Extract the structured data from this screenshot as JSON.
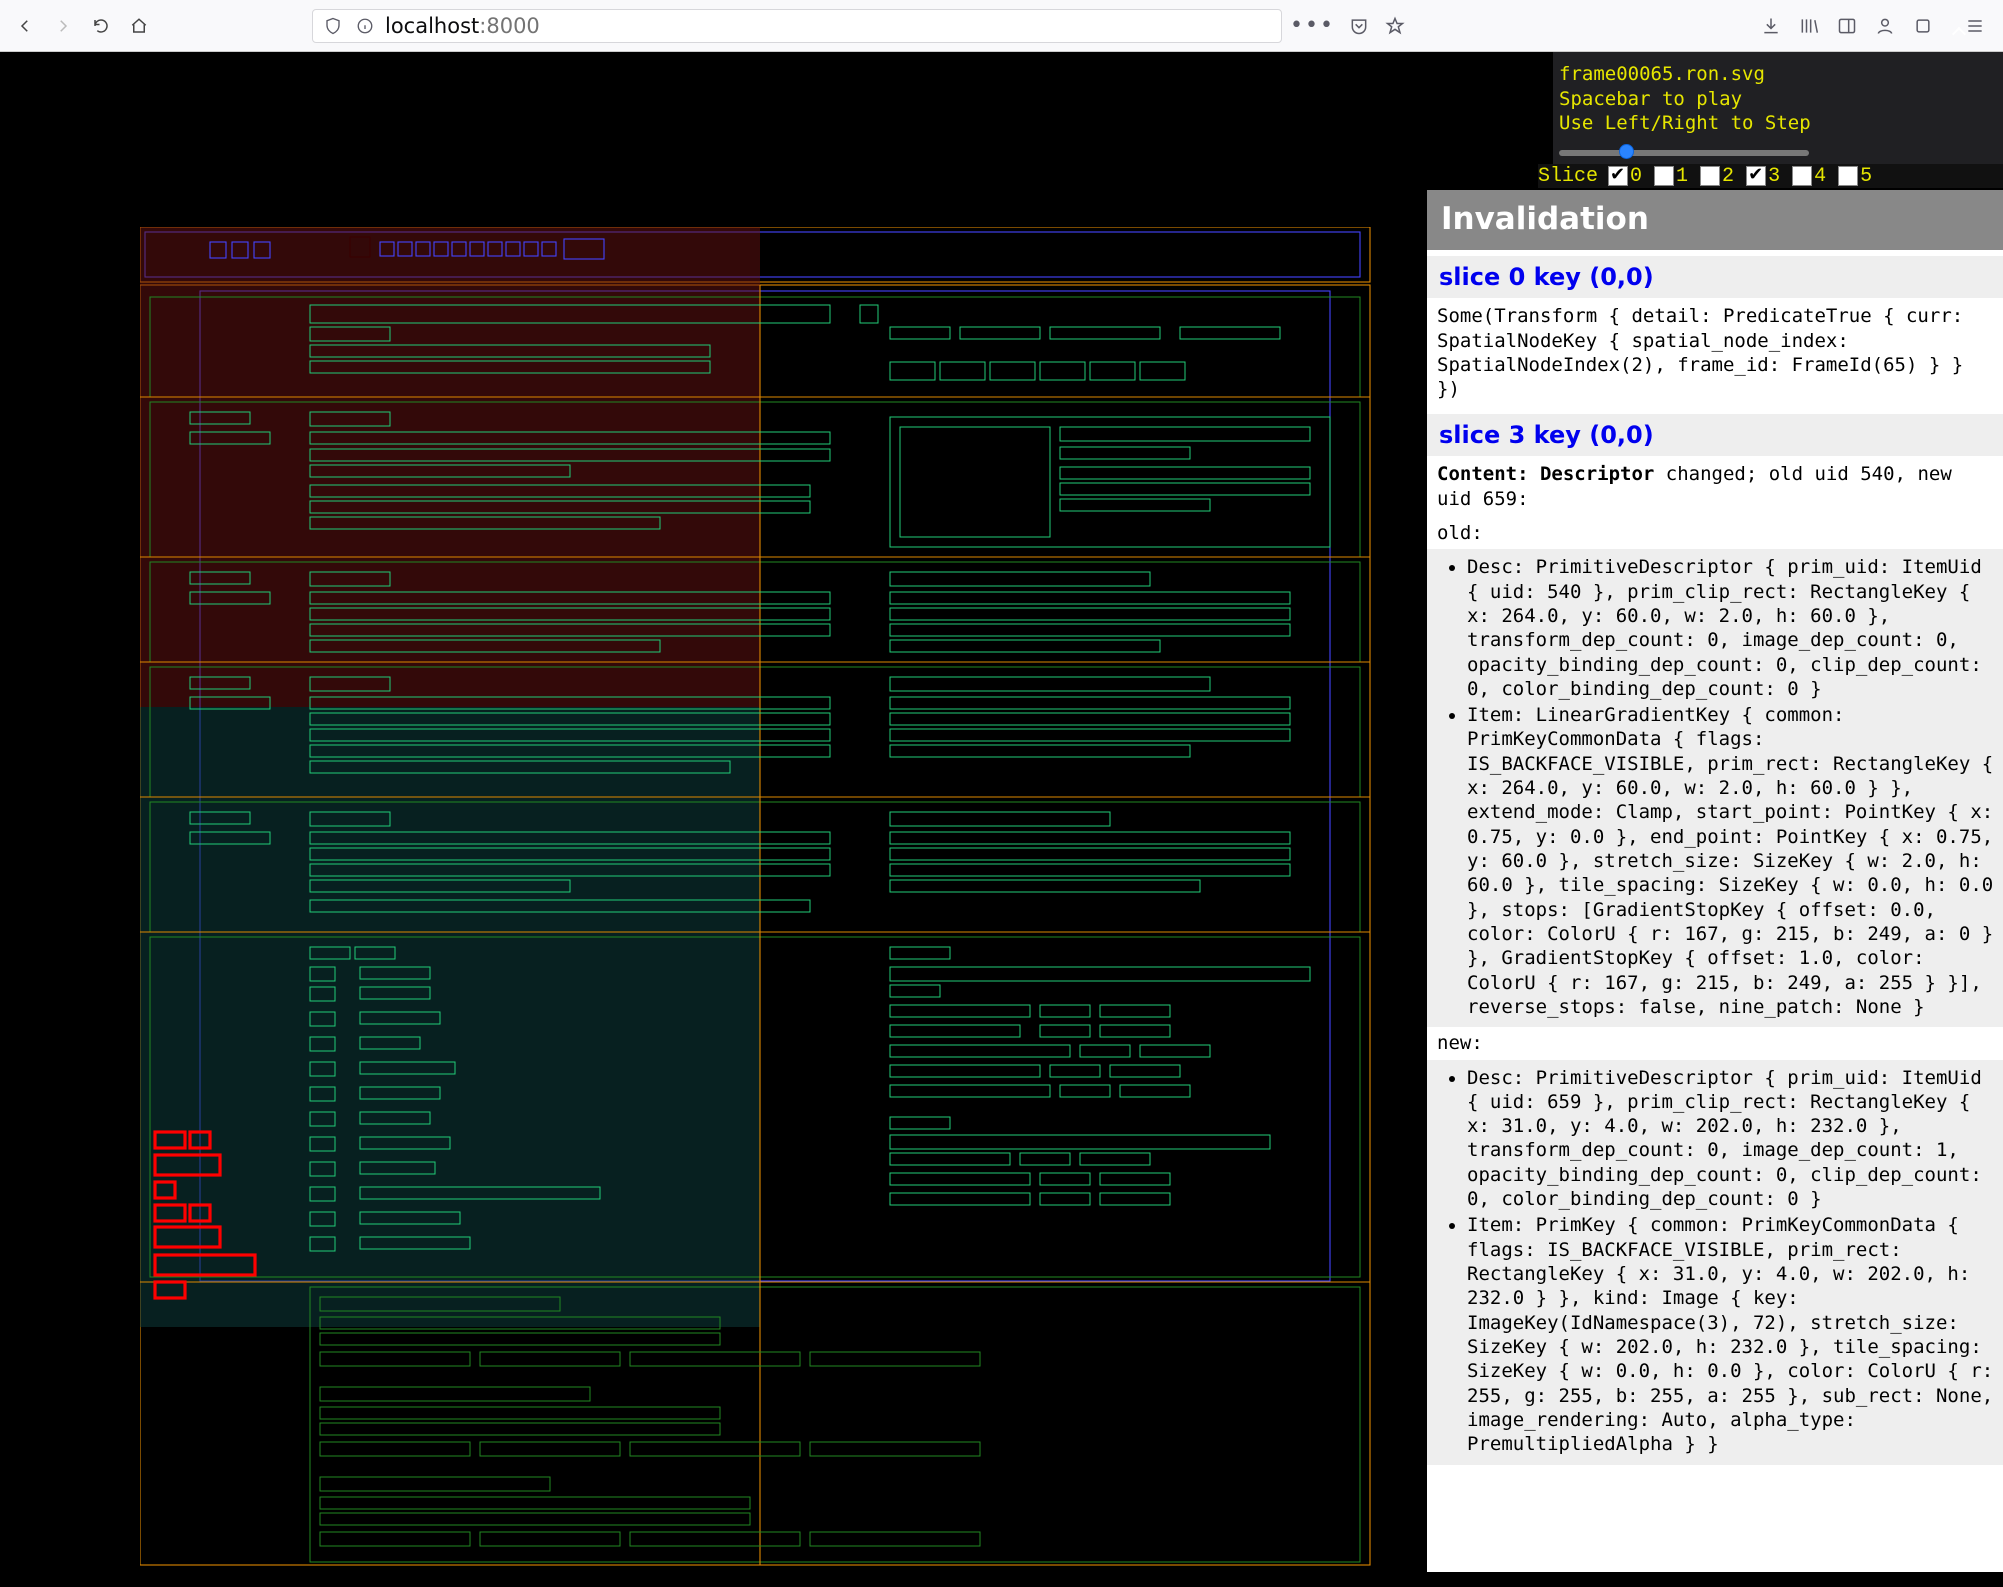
{
  "browser": {
    "hostname": "localhost",
    "port": ":8000"
  },
  "header": {
    "filename": "frame00065.ron.svg",
    "hint_play": "Spacebar to play",
    "hint_step": "Use Left/Right to Step"
  },
  "slicebar": {
    "label": "Slice",
    "options": [
      {
        "n": "0",
        "checked": true
      },
      {
        "n": "1",
        "checked": false
      },
      {
        "n": "2",
        "checked": false
      },
      {
        "n": "3",
        "checked": true
      },
      {
        "n": "4",
        "checked": false
      },
      {
        "n": "5",
        "checked": false
      }
    ]
  },
  "panel": {
    "title": "Invalidation",
    "slice0": {
      "heading": "slice 0 key (0,0)",
      "body": "Some(Transform { detail: PredicateTrue { curr: SpatialNodeKey { spatial_node_index: SpatialNodeIndex(2), frame_id: FrameId(65) } } })"
    },
    "slice3": {
      "heading": "slice 3 key (0,0)",
      "content_line_b": "Content: Descriptor",
      "content_line_rest": " changed; old uid 540, new uid 659:",
      "old_label": "old:",
      "old_items": [
        "Desc: PrimitiveDescriptor { prim_uid: ItemUid { uid: 540 }, prim_clip_rect: RectangleKey { x: 264.0, y: 60.0, w: 2.0, h: 60.0 }, transform_dep_count: 0, image_dep_count: 0, opacity_binding_dep_count: 0, clip_dep_count: 0, color_binding_dep_count: 0 }",
        "Item: LinearGradientKey { common: PrimKeyCommonData { flags: IS_BACKFACE_VISIBLE, prim_rect: RectangleKey { x: 264.0, y: 60.0, w: 2.0, h: 60.0 } }, extend_mode: Clamp, start_point: PointKey { x: 0.75, y: 0.0 }, end_point: PointKey { x: 0.75, y: 60.0 }, stretch_size: SizeKey { w: 2.0, h: 60.0 }, tile_spacing: SizeKey { w: 0.0, h: 0.0 }, stops: [GradientStopKey { offset: 0.0, color: ColorU { r: 167, g: 215, b: 249, a: 0 } }, GradientStopKey { offset: 1.0, color: ColorU { r: 167, g: 215, b: 249, a: 255 } }], reverse_stops: false, nine_patch: None }"
      ],
      "new_label": "new:",
      "new_items": [
        "Desc: PrimitiveDescriptor { prim_uid: ItemUid { uid: 659 }, prim_clip_rect: RectangleKey { x: 31.0, y: 4.0, w: 202.0, h: 232.0 }, transform_dep_count: 0, image_dep_count: 1, opacity_binding_dep_count: 0, clip_dep_count: 0, color_binding_dep_count: 0 }",
        "Item: PrimKey { common: PrimKeyCommonData { flags: IS_BACKFACE_VISIBLE, prim_rect: RectangleKey { x: 31.0, y: 4.0, w: 202.0, h: 232.0 } }, kind: Image { key: ImageKey(IdNamespace(3), 72), stretch_size: SizeKey { w: 202.0, h: 232.0 }, tile_spacing: SizeKey { w: 0.0, h: 0.0 }, color: ColorU { r: 255, g: 255, b: 255, a: 255 }, sub_rect: None, image_rendering: Auto, alpha_type: PremultipliedAlpha } }"
      ]
    }
  }
}
